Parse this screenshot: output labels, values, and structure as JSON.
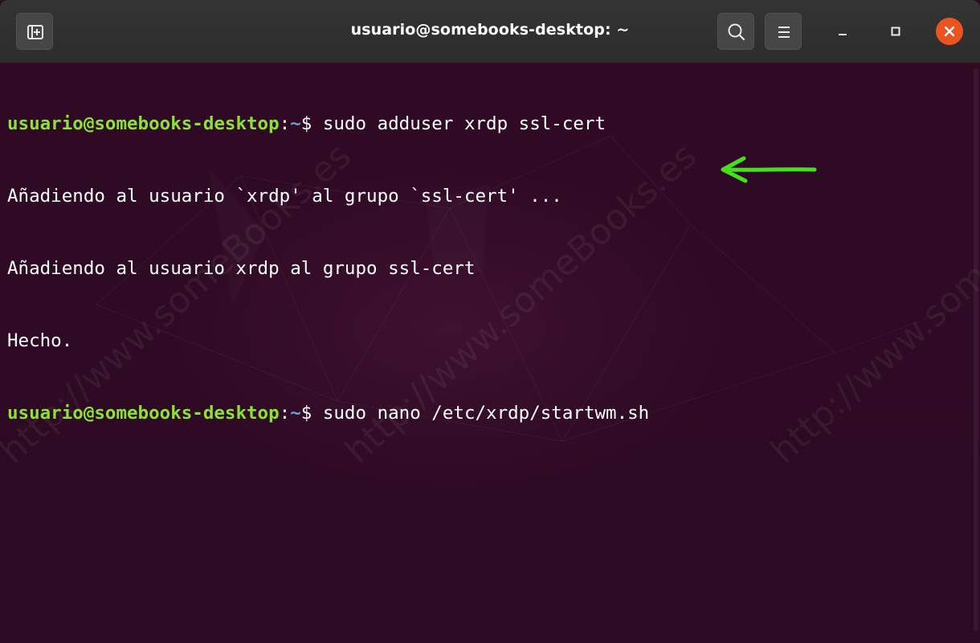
{
  "window": {
    "title": "usuario@somebooks-desktop: ~"
  },
  "header": {
    "new_tab_icon": "new-tab-icon",
    "search_icon": "search-icon",
    "menu_icon": "hamburger-menu-icon",
    "window_controls": [
      "minimize-icon",
      "maximize-icon",
      "close-icon"
    ]
  },
  "colors": {
    "prompt_user": "#8ae234",
    "prompt_path": "#729fcf",
    "terminal_bg": "#300a24",
    "close_button": "#e95420",
    "annotation_arrow": "#44e01a"
  },
  "terminal": {
    "lines": [
      {
        "user": "usuario@somebooks-desktop",
        "sep": ":",
        "path": "~",
        "cmd": "$ sudo adduser xrdp ssl-cert"
      },
      {
        "text": "Añadiendo al usuario `xrdp' al grupo `ssl-cert' ..."
      },
      {
        "text": "Añadiendo al usuario xrdp al grupo ssl-cert"
      },
      {
        "text": "Hecho."
      },
      {
        "user": "usuario@somebooks-desktop",
        "sep": ":",
        "path": "~",
        "cmd": "$ sudo nano /etc/xrdp/startwm.sh"
      }
    ]
  },
  "watermark": {
    "text": "http://www.someBooks.es"
  }
}
